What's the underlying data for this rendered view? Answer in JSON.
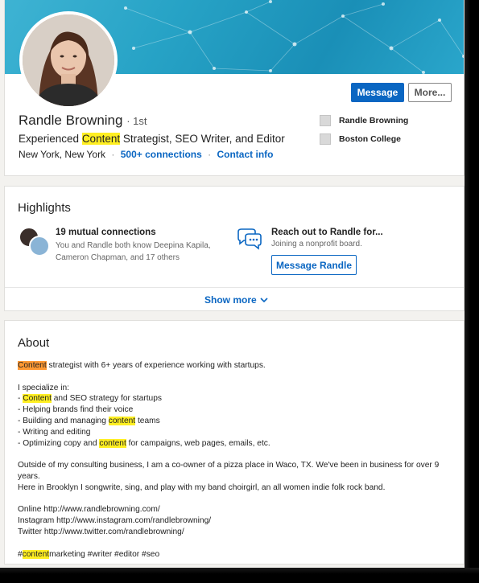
{
  "profile": {
    "name": "Randle Browning",
    "degree": "1st",
    "headline_pre": "Experienced ",
    "headline_highlight": "Content",
    "headline_post": " Strategist, SEO Writer, and Editor",
    "location": "New York, New York",
    "connections": "500+ connections",
    "contact_info": "Contact info"
  },
  "actions": {
    "message": "Message",
    "more": "More..."
  },
  "side": {
    "current": "Randle Browning",
    "school": "Boston College"
  },
  "highlights": {
    "title": "Highlights",
    "mutual_title": "19 mutual connections",
    "mutual_desc": "You and Randle both know Deepina Kapila, Cameron Chapman, and 17 others",
    "reach_title": "Reach out to Randle for...",
    "reach_desc": "Joining a nonprofit board.",
    "message_button": "Message Randle",
    "show_more": "Show more"
  },
  "about": {
    "title": "About",
    "l1_hl": "Content",
    "l1_rest": " strategist with 6+ years of experience working with startups.",
    "l2": "I specialize in:",
    "l3_pre": "- ",
    "l3_hl": "Content",
    "l3_rest": " and SEO strategy for startups",
    "l4": "- Helping brands find their voice",
    "l5_pre": "- Building and managing ",
    "l5_hl": "content",
    "l5_rest": " teams",
    "l6": "- Writing and editing",
    "l7_pre": "- Optimizing copy and ",
    "l7_hl": "content",
    "l7_rest": " for campaigns, web pages, emails, etc.",
    "l8": "Outside of my consulting business, I am a co-owner of a pizza place in Waco, TX. We've been in business for over 9 years.",
    "l9": "Here in Brooklyn I songwrite, sing, and play with my band choirgirl, an all women indie folk rock band.",
    "l10": "Online http://www.randlebrowning.com/",
    "l11": "Instagram http://www.instagram.com/randlebrowning/",
    "l12": "Twitter http://www.twitter.com/randlebrowning/",
    "l13_pre": "#",
    "l13_hl": "content",
    "l13_rest": "marketing #writer #editor #seo"
  },
  "colors": {
    "linkedin_blue": "#0a66c2",
    "highlight_yellow": "#ffef22",
    "highlight_orange": "#ff9933"
  }
}
